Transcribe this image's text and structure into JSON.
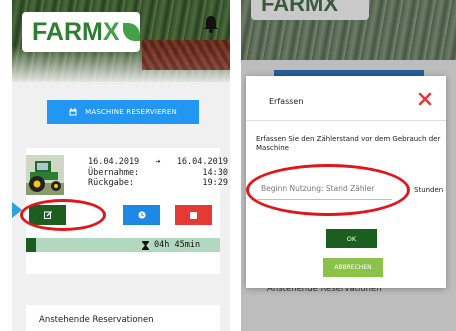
{
  "left_screen": {
    "logo": {
      "text": "FARM",
      "x_letter": "X"
    },
    "reserve_button": {
      "label": "MASCHINE RESERVIEREN"
    },
    "reservation": {
      "start_date": "16.04.2019",
      "end_date": "16.04.2019",
      "takeover_label": "Übernahme:",
      "takeover_time": "14:30",
      "return_label": "Rückgabe:",
      "return_time": "19:29"
    },
    "duration": "04h 45min",
    "progress_fraction": 0.05,
    "upcoming_title": "Anstehende Reservationen"
  },
  "right_screen": {
    "logo": {
      "text": "FARMX"
    },
    "modal": {
      "title": "Erfassen",
      "instruction": "Erfassen Sie den Zählerstand vor dem Gebrauch der Maschine",
      "input_placeholder": "Beginn Nutzung: Stand Zähler",
      "unit": "Stunden",
      "ok_label": "OK",
      "abort_label": "ABBRECHEN"
    },
    "upcoming_title": "Anstehende Reservationen"
  },
  "colors": {
    "brand_green": "#1b5e20",
    "accent_blue": "#2196f3",
    "danger_red": "#e53935",
    "highlight_red": "#e0161b",
    "light_green": "#8bc34a"
  },
  "icons": [
    "bell-icon",
    "calendar-icon",
    "tractor-image",
    "edit-icon",
    "clock-icon",
    "stop-icon",
    "hourglass-icon",
    "close-icon"
  ]
}
